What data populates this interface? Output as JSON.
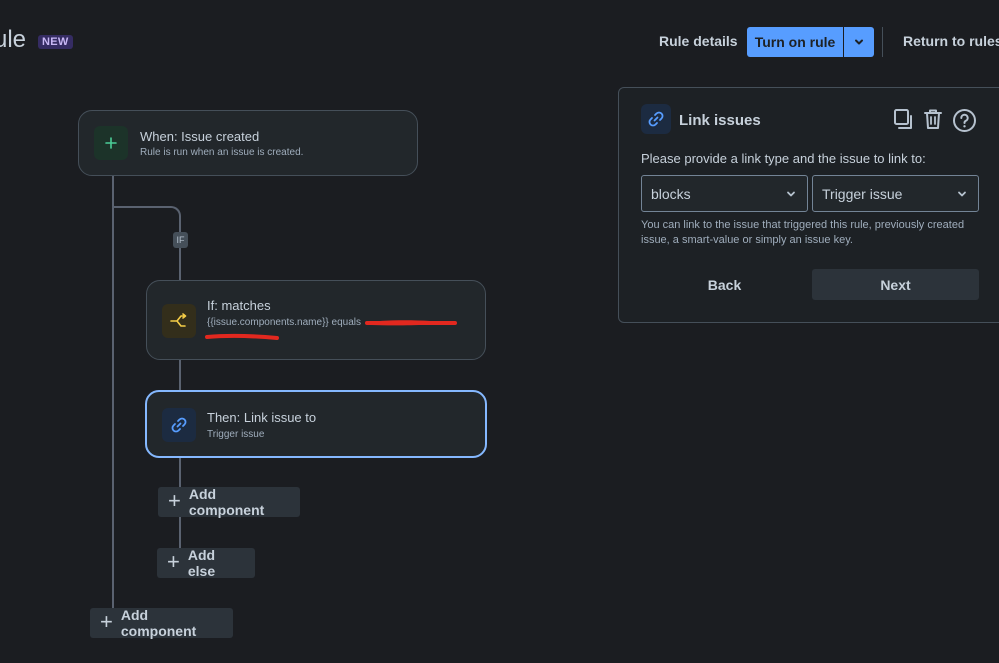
{
  "header": {
    "title": "ule",
    "badge": "NEW",
    "rule_details": "Rule details",
    "turn_on": "Turn on rule",
    "return": "Return to rules"
  },
  "flow": {
    "trigger": {
      "title": "When: Issue created",
      "subtitle": "Rule is run when an issue is created.",
      "icon": "plus-icon"
    },
    "if_badge": "IF",
    "condition": {
      "title": "If: matches",
      "subtitle": "{{issue.components.name}} equals",
      "icon": "branch-icon"
    },
    "action": {
      "title": "Then: Link issue to",
      "subtitle": "Trigger issue",
      "icon": "link-icon"
    },
    "add_component_inner": "Add component",
    "add_else": "Add else",
    "add_component_outer": "Add component"
  },
  "panel": {
    "title": "Link issues",
    "prompt": "Please provide a link type and the issue to link to:",
    "link_type": "blocks",
    "link_target": "Trigger issue",
    "help": "You can link to the issue that triggered this rule, previously created issue, a smart-value or simply an issue key.",
    "back": "Back",
    "next": "Next"
  },
  "colors": {
    "accent": "#579dff",
    "selected_border": "#85b8ff",
    "trigger_icon": "#4bce97",
    "condition_icon": "#f5cd47",
    "redaction": "#e2281f"
  }
}
